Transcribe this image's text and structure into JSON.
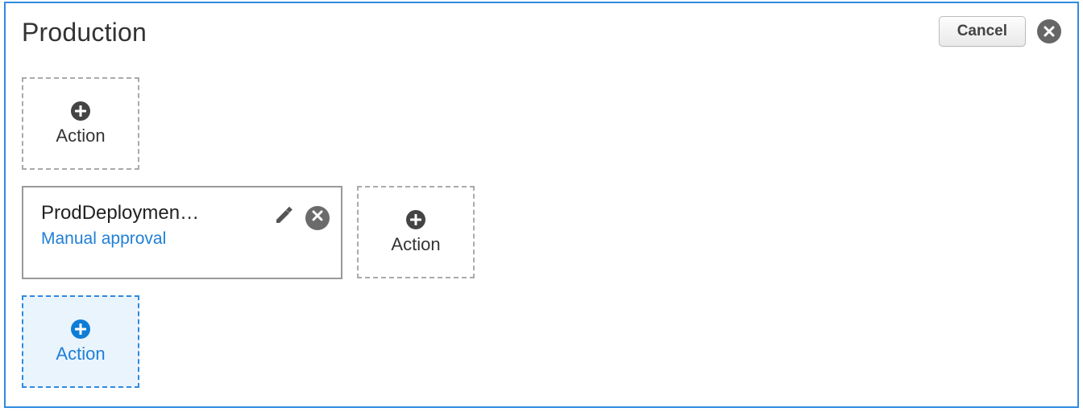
{
  "stage": {
    "title": "Production",
    "cancel_label": "Cancel",
    "add_action_label": "Action",
    "action": {
      "name": "ProdDeploymen…",
      "subtype": "Manual approval"
    }
  }
}
